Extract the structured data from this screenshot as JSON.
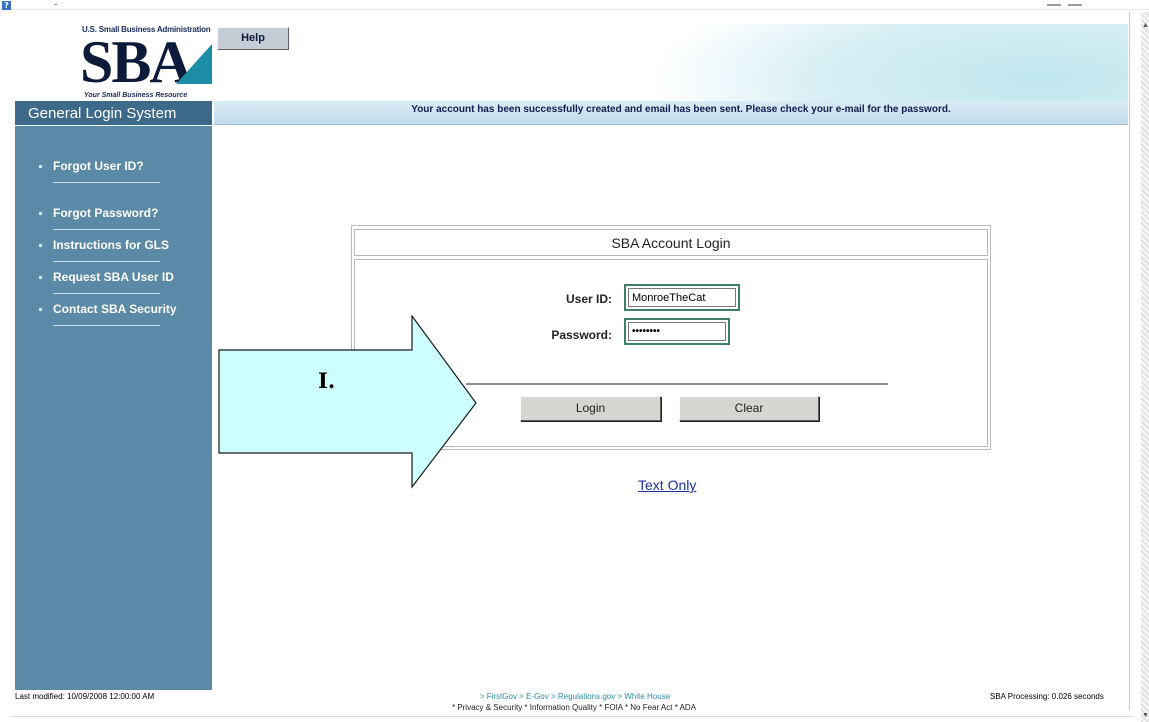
{
  "header": {
    "org_name": "U.S. Small Business Administration",
    "logo_mark": "SBA",
    "tagline": "Your Small Business Resource",
    "help_label": "Help"
  },
  "banner": {
    "message": "Your account has been successfully created and email has been sent. Please check your e-mail for the password."
  },
  "sidebar": {
    "title": "General Login System",
    "items": [
      {
        "label": "Forgot User ID?"
      },
      {
        "label": "Forgot Password?"
      },
      {
        "label": "Instructions for GLS"
      },
      {
        "label": "Request SBA User ID"
      },
      {
        "label": "Contact SBA Security"
      }
    ]
  },
  "login": {
    "title": "SBA Account Login",
    "userid_label": "User ID:",
    "userid_value": "MonroeTheCat",
    "password_label": "Password:",
    "password_value": "••••••••",
    "login_button": "Login",
    "clear_button": "Clear"
  },
  "text_only_link": "Text Only",
  "annotation": {
    "label": "I.",
    "color": "#ccfffe"
  },
  "footer": {
    "last_modified": "Last modified: 10/09/2008 12:00:00 AM",
    "links_row1": "> FirstGov   > E-Gov   > Regulations.gov   > White House",
    "links_row2": "* Privacy & Security  * Information Quality  * FOIA  * No Fear Act  * ADA",
    "processing": "SBA Processing:  0.026 seconds"
  },
  "colors": {
    "sidebar": "#5a8aa6",
    "sidebar_title": "#3d6a89",
    "banner": "#c2dceb",
    "input_border": "#3d7f69",
    "link": "#1c2f9e"
  }
}
